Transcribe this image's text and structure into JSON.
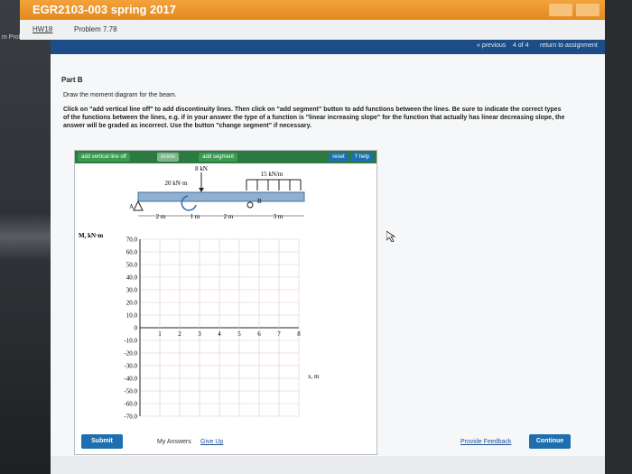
{
  "window": {
    "title": "EGR2103-003 spring 2017"
  },
  "tabs": {
    "hw": "HW18",
    "problem": "Problem 7.78"
  },
  "left_strip": {
    "fragment": "m Prob"
  },
  "nav": {
    "previous": "« previous",
    "position": "4 of 4",
    "return": "return to assignment"
  },
  "part": {
    "label": "Part B"
  },
  "task": "Draw the moment diagram for the beam.",
  "instructions": "Click on \"add vertical line off\" to add discontinuity lines. Then click on \"add segment\" button to add functions between the lines. Be sure to indicate the correct types of the functions between the lines, e.g. if in your answer the type of a function is \"linear increasing slope\" for the function that actually has linear decreasing slope, the answer will be graded as incorrect. Use the button \"change segment\" if necessary.",
  "toolbar": {
    "add_vertical": "add vertical line off",
    "delete": "delete",
    "add_segment": "add segment",
    "reset": "reset",
    "help": "? help"
  },
  "beam": {
    "force_label": "8 kN",
    "moment_label": "20 kN·m",
    "dist_load_label": "15 kN/m",
    "support_a": "A",
    "support_b": "B",
    "dim1": "2 m",
    "dim2": "1 m",
    "dim3": "2 m",
    "dim4": "3 m"
  },
  "plot": {
    "ylabel": "M, kN·m",
    "xlabel": "x, m",
    "yticks": [
      "70.0",
      "60.0",
      "50.0",
      "40.0",
      "30.0",
      "20.0",
      "10.0",
      "0",
      "-10.0",
      "-20.0",
      "-30.0",
      "-40.0",
      "-50.0",
      "-60.0",
      "-70.0"
    ],
    "xticks": [
      "1",
      "2",
      "3",
      "4",
      "5",
      "6",
      "7",
      "8"
    ]
  },
  "footer": {
    "submit": "Submit",
    "my_answers": "My Answers",
    "give_up": "Give Up",
    "feedback": "Provide Feedback",
    "continue": "Continue"
  },
  "colors": {
    "orange": "#e8932a",
    "nav_blue": "#1c4d86",
    "toolbar_green": "#2c7a3f",
    "button_blue": "#1f6fb0"
  }
}
